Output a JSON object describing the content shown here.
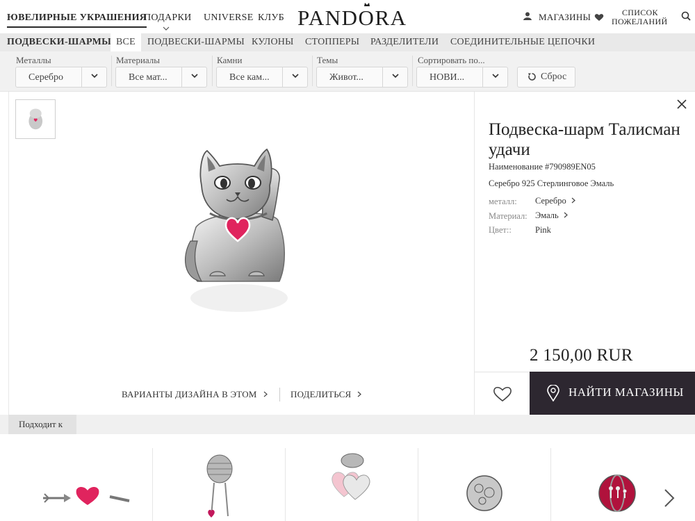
{
  "topnav": {
    "jewelry": "ЮВЕЛИРНЫЕ УКРАШЕНИЯ",
    "gifts": "ПОДАРКИ",
    "universe": "UNIVERSE",
    "club": "КЛУБ",
    "logo": "PANDORA",
    "stores": "МАГАЗИНЫ",
    "wishlist_line1": "СПИСОК",
    "wishlist_line2": "ПОЖЕЛАНИЙ"
  },
  "categories": {
    "title": "ПОДВЕСКИ-ШАРМЫ",
    "tabs": [
      "ВСЕ",
      "ПОДВЕСКИ-ШАРМЫ",
      "КУЛОНЫ",
      "СТОППЕРЫ",
      "РАЗДЕЛИТЕЛИ",
      "СОЕДИНИТЕЛЬНЫЕ ЦЕПОЧКИ"
    ],
    "active_tab": "ВСЕ"
  },
  "filters": [
    {
      "label": "Металлы",
      "value": "Серебро"
    },
    {
      "label": "Материалы",
      "value": "Все мат..."
    },
    {
      "label": "Камни",
      "value": "Все кам..."
    },
    {
      "label": "Темы",
      "value": "Живот..."
    },
    {
      "label": "Сортировать по...",
      "value": "НОВИ..."
    }
  ],
  "reset_label": "Сброс",
  "product": {
    "title": "Подвеска-шарм Талисман удачи",
    "sku": "Наименование #790989EN05",
    "material_line": "Серебро 925 Стерлинговое Эмаль",
    "attributes": [
      {
        "label": "металл:",
        "value": "Серебро",
        "link": true
      },
      {
        "label": "Материал:",
        "value": "Эмаль",
        "link": true
      },
      {
        "label": "Цвет::",
        "value": "Pink",
        "link": false
      }
    ],
    "price": "2 150,00 RUR",
    "find_stores": "НАЙТИ МАГАЗИНЫ",
    "design_variants": "ВАРИАНТЫ ДИЗАЙНА В ЭТОМ",
    "share": "ПОДЕЛИТЬСЯ"
  },
  "related": {
    "tab_label": "Подходит к"
  },
  "colors": {
    "accent_dark": "#2d2730",
    "heart_pink": "#e0245e"
  },
  "icons": [
    "user-icon",
    "heart-icon",
    "search-icon",
    "chevron-down-icon",
    "reset-icon",
    "close-icon",
    "location-pin-icon",
    "chevron-right-icon"
  ]
}
